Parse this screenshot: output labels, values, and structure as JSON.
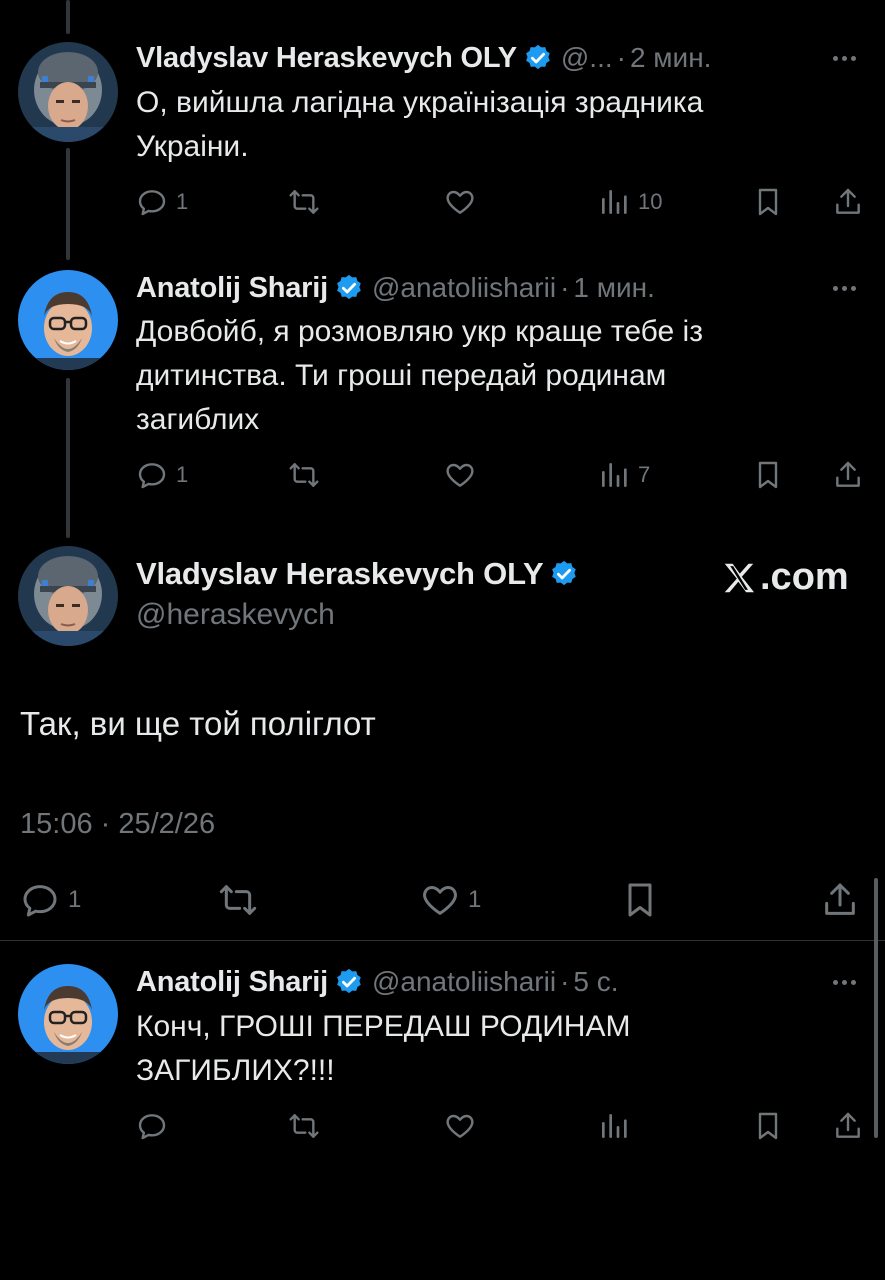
{
  "colors": {
    "background": "#000000",
    "text": "#e7e9ea",
    "muted": "#71767b",
    "verified": "#1d9bf0",
    "line": "#333639"
  },
  "tweets": [
    {
      "author": "Vladyslav Heraskevych OLY",
      "handle": "@...",
      "time": "2 мин.",
      "text_lines": [
        "О, вийшла лагідна українізація зрадника",
        "Украіни."
      ],
      "replies": "1",
      "views": "10"
    },
    {
      "author": "Anatolij Sharij",
      "handle": "@anatoliisharii",
      "time": "1 мин.",
      "text_lines": [
        "Довбойб, я розмовляю укр краще тебе із",
        "дитинства. Ти гроші передай родинам",
        "загиблих"
      ],
      "replies": "1",
      "views": "7"
    }
  ],
  "main_tweet": {
    "author": "Vladyslav Heraskevych OLY",
    "handle": "@heraskevych",
    "site": ".com",
    "text": "Так, ви ще той поліглот",
    "timestamp": "15:06 · 25/2/26",
    "replies": "1",
    "likes": "1"
  },
  "reply": {
    "author": "Anatolij Sharij",
    "handle": "@anatoliisharii",
    "time": "5 с.",
    "text_lines": [
      "Конч, ГРОШІ ПЕРЕДАШ РОДИНАМ",
      "ЗАГИБЛИХ?!!!"
    ]
  },
  "icons": [
    "reply-icon",
    "retweet-icon",
    "like-icon",
    "views-icon",
    "bookmark-icon",
    "share-icon",
    "verified-icon",
    "more-icon",
    "x-logo-icon"
  ]
}
